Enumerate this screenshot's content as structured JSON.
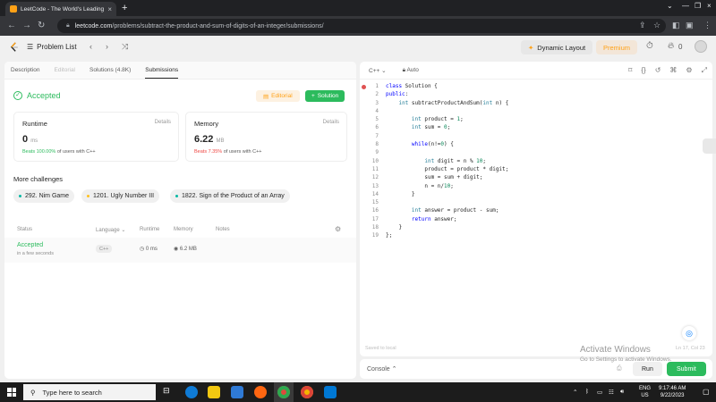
{
  "browser": {
    "tab_title": "LeetCode - The World's Leading",
    "url_host": "leetcode.com",
    "url_path": "/problems/subtract-the-product-and-sum-of-digits-of-an-integer/submissions/"
  },
  "lc_nav": {
    "problem_list": "Problem List",
    "dynamic_layout": "Dynamic Layout",
    "premium": "Premium",
    "streak": "0"
  },
  "left_tabs": [
    "Description",
    "Editorial",
    "Solutions (4.8K)",
    "Submissions"
  ],
  "result": {
    "status": "Accepted",
    "editorial_btn": "Editorial",
    "solution_btn": "Solution",
    "runtime": {
      "label": "Runtime",
      "details": "Details",
      "value": "0",
      "unit": "ms",
      "beats_pct": "Beats 100.00%",
      "beats_rest": "of users with C++"
    },
    "memory": {
      "label": "Memory",
      "details": "Details",
      "value": "6.22",
      "unit": "MB",
      "beats_pct": "Beats 7.35%",
      "beats_rest": "of users with C++"
    }
  },
  "challenges": {
    "title": "More challenges",
    "items": [
      {
        "label": "292. Nim Game",
        "color": "#00b8a3"
      },
      {
        "label": "1201. Ugly Number III",
        "color": "#ffc01e"
      },
      {
        "label": "1822. Sign of the Product of an Array",
        "color": "#00b8a3"
      }
    ]
  },
  "submissions": {
    "headers": [
      "Status",
      "Language",
      "Runtime",
      "Memory",
      "Notes"
    ],
    "rows": [
      {
        "status": "Accepted",
        "when": "in a few seconds",
        "language": "C++",
        "runtime": "0 ms",
        "memory": "6.2 MB"
      }
    ]
  },
  "editor": {
    "language": "C++",
    "mode": "Auto",
    "saved": "Saved to local",
    "position": "Ln 17, Col 23",
    "lines": [
      "class Solution {",
      "public:",
      "    int subtractProductAndSum(int n) {",
      "",
      "        int product = 1;",
      "        int sum = 0;",
      "",
      "        while(n!=0) {",
      "",
      "            int digit = n % 10;",
      "            product = product * digit;",
      "            sum = sum + digit;",
      "            n = n/10;",
      "        }",
      "",
      "        int answer = product - sum;",
      "        return answer;",
      "    }",
      "};"
    ]
  },
  "console": {
    "label": "Console",
    "run": "Run",
    "submit": "Submit"
  },
  "watermark": {
    "line1": "Activate Windows",
    "line2": "Go to Settings to activate Windows."
  },
  "taskbar": {
    "search_placeholder": "Type here to search",
    "lang1": "ENG",
    "lang2": "US",
    "time": "9:17:46 AM",
    "date": "9/22/2023"
  }
}
